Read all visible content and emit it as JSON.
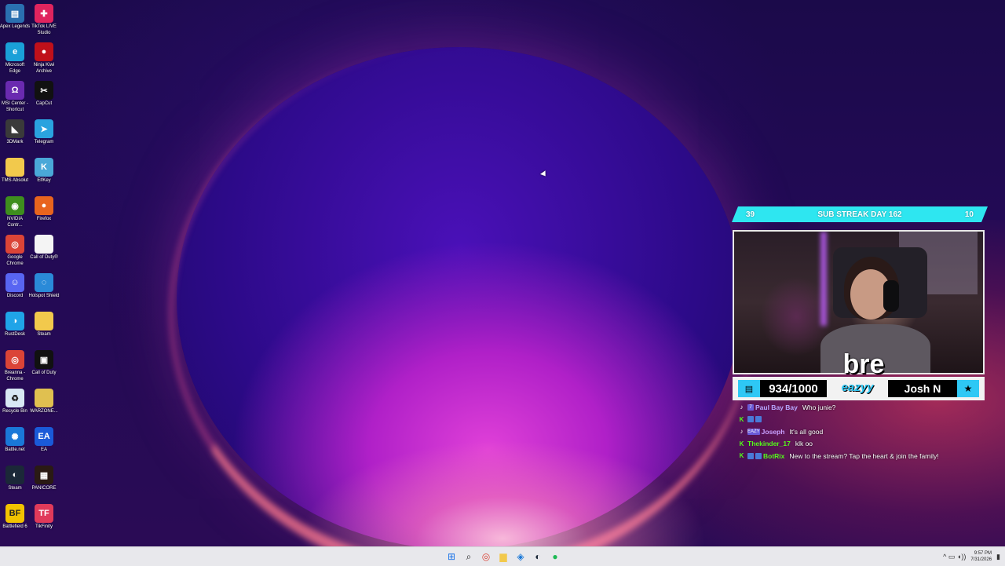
{
  "desktop": {
    "icons": [
      {
        "label": "Apex Legends",
        "icon": "apex-icon",
        "color": "#2a6fb0",
        "glyph": "▤"
      },
      {
        "label": "TikTok LIVE Studio",
        "icon": "tiktok-live-icon",
        "color": "#e0245e",
        "glyph": "✚"
      },
      {
        "label": "Microsoft Edge",
        "icon": "edge-icon",
        "color": "#1aa0d8",
        "glyph": "e"
      },
      {
        "label": "Ninja Kiwi Archive",
        "icon": "ninja-kiwi-icon",
        "color": "#c0101a",
        "glyph": "●"
      },
      {
        "label": "MSI Center - Shortcut",
        "icon": "msi-center-icon",
        "color": "#6a2ab0",
        "glyph": "Ω"
      },
      {
        "label": "CapCut",
        "icon": "capcut-icon",
        "color": "#111111",
        "glyph": "✂"
      },
      {
        "label": "3DMark",
        "icon": "3dmark-icon",
        "color": "#3a3a3a",
        "glyph": "◣"
      },
      {
        "label": "Telegram",
        "icon": "telegram-icon",
        "color": "#2aa3df",
        "glyph": "➤"
      },
      {
        "label": "TMS Absolut",
        "icon": "folder-icon",
        "color": "#f2c94c",
        "glyph": ""
      },
      {
        "label": "ElfKey",
        "icon": "elfkey-icon",
        "color": "#4aa8d8",
        "glyph": "K"
      },
      {
        "label": "NVIDIA Contr...",
        "icon": "nvidia-icon",
        "color": "#3e8e1e",
        "glyph": "◉"
      },
      {
        "label": "Firefox",
        "icon": "firefox-icon",
        "color": "#e8641e",
        "glyph": "●"
      },
      {
        "label": "Google Chrome",
        "icon": "chrome-icon",
        "color": "#db4437",
        "glyph": "◎"
      },
      {
        "label": "Call of Duty®",
        "icon": "file-icon",
        "color": "#f4f4f4",
        "glyph": ""
      },
      {
        "label": "Discord",
        "icon": "discord-icon",
        "color": "#5865f2",
        "glyph": "☺"
      },
      {
        "label": "Hotspot Shield",
        "icon": "hotspot-shield-icon",
        "color": "#2a8ad8",
        "glyph": "◌"
      },
      {
        "label": "RustDesk",
        "icon": "rustdesk-icon",
        "color": "#1fa4e8",
        "glyph": "◑"
      },
      {
        "label": "Steam",
        "icon": "folder-icon",
        "color": "#f2c94c",
        "glyph": ""
      },
      {
        "label": "Breanna - Chrome",
        "icon": "chrome-profile-icon",
        "color": "#db4437",
        "glyph": "◎"
      },
      {
        "label": "Call of Duty",
        "icon": "call-of-duty-icon",
        "color": "#111111",
        "glyph": "▣"
      },
      {
        "label": "Recycle Bin",
        "icon": "recycle-bin-icon",
        "color": "#d8e8f4",
        "glyph": "♻"
      },
      {
        "label": "WARZONE...",
        "icon": "warzone-folder-icon",
        "color": "#e0c050",
        "glyph": ""
      },
      {
        "label": "Battle.net",
        "icon": "battlenet-icon",
        "color": "#1a78d8",
        "glyph": "✺"
      },
      {
        "label": "EA",
        "icon": "ea-icon",
        "color": "#1a5ad8",
        "glyph": "EA"
      },
      {
        "label": "Steam",
        "icon": "steam-icon",
        "color": "#1b2838",
        "glyph": "◐"
      },
      {
        "label": "PANICORE",
        "icon": "panicore-icon",
        "color": "#2a1a14",
        "glyph": "▦"
      },
      {
        "label": "Battlefield 6",
        "icon": "battlefield-icon",
        "color": "#f2c200",
        "glyph": "BF"
      },
      {
        "label": "TikFinity",
        "icon": "tikfinity-icon",
        "color": "#e03a5a",
        "glyph": "TF"
      }
    ]
  },
  "overlay": {
    "streak_left": "39",
    "streak_title": "SUB STREAK DAY 162",
    "streak_right": "10",
    "sub_count": "934/1000",
    "sub_name": "Josh N",
    "logo_text": "bre",
    "logo_sub": "eazyy"
  },
  "chat": [
    {
      "platform": "tiktok",
      "badges": [
        "7"
      ],
      "user": "Paul Bay Bay",
      "user_color": "#b8a8ff",
      "message": "Who junie?"
    },
    {
      "platform": "kick",
      "badges": [
        "",
        ""
      ],
      "user": "",
      "user_color": "#53fc18",
      "message": ""
    },
    {
      "platform": "tiktok",
      "badges": [
        "EAZY"
      ],
      "user": "Joseph",
      "user_color": "#c8a0ff",
      "message": "It's all good"
    },
    {
      "platform": "kick",
      "badges": [],
      "user": "Thekinder_17",
      "user_color": "#53fc18",
      "message": "klk oo"
    },
    {
      "platform": "kick",
      "badges": [
        "",
        ""
      ],
      "user": "BotRix",
      "user_color": "#53fc18",
      "message": "New to the stream? Tap the heart & join the family!"
    }
  ],
  "taskbar": {
    "apps": [
      {
        "icon": "windows-start-icon",
        "glyph": "⊞",
        "color": "#1a73e8"
      },
      {
        "icon": "search-icon",
        "glyph": "⌕",
        "color": "#222222"
      },
      {
        "icon": "chrome-icon",
        "glyph": "◎",
        "color": "#db4437"
      },
      {
        "icon": "file-explorer-icon",
        "glyph": "▆",
        "color": "#f2c94c"
      },
      {
        "icon": "app-blue-icon",
        "glyph": "◈",
        "color": "#1a78d8"
      },
      {
        "icon": "steam-icon",
        "glyph": "◐",
        "color": "#1b2838"
      },
      {
        "icon": "spotify-icon",
        "glyph": "●",
        "color": "#1db954"
      }
    ],
    "tray_glyphs": "^  ▭  ◖))",
    "time": "9:57 PM",
    "date": "7/31/2026"
  }
}
